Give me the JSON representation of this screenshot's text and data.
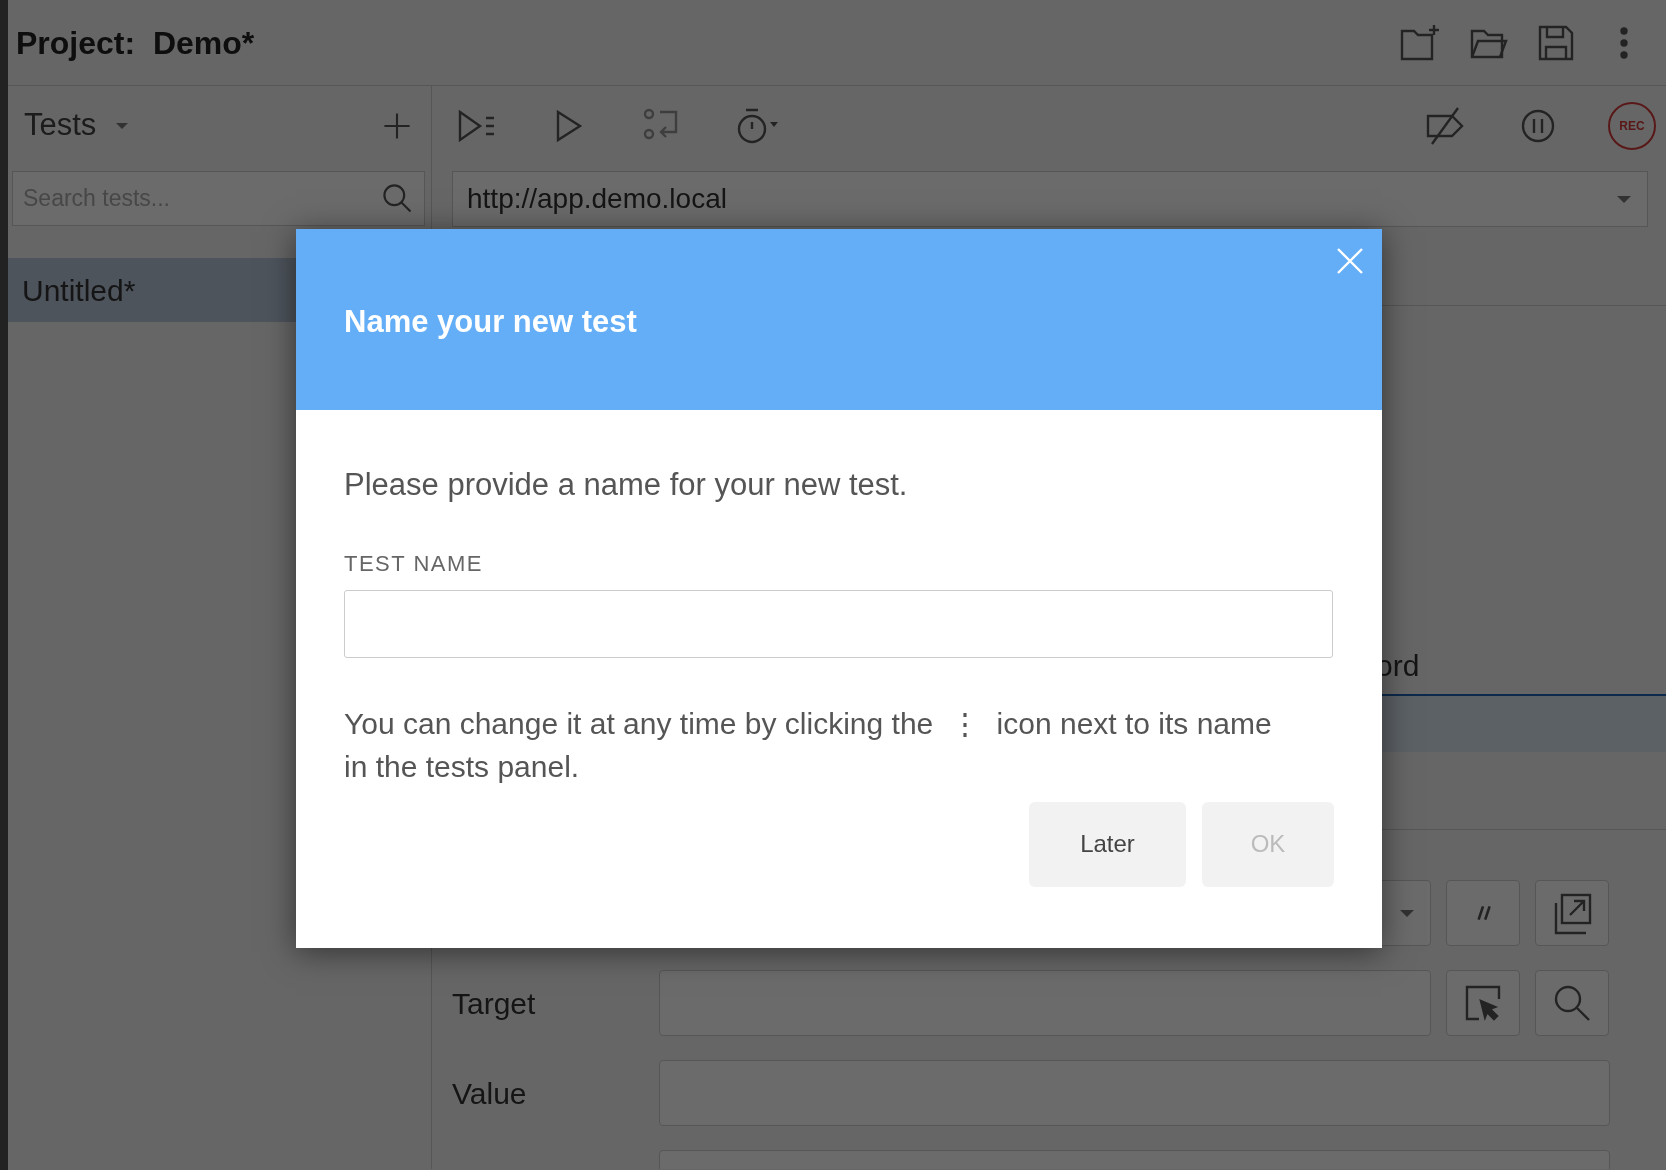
{
  "project": {
    "label": "Project:",
    "name": "Demo*"
  },
  "tests_panel": {
    "title": "Tests",
    "search": {
      "placeholder": "Search tests..."
    },
    "items": [
      {
        "name": "Untitled*",
        "selected": true
      }
    ]
  },
  "toolbar": {
    "record_label": "REC"
  },
  "url_bar": {
    "value": "http://app.demo.local"
  },
  "command_table": {
    "rows": [
      {
        "text": "ord",
        "selected": false
      },
      {
        "selected": true
      }
    ]
  },
  "command_editor": {
    "fields": [
      {
        "label": "Target"
      },
      {
        "label": "Value"
      }
    ]
  },
  "dialog": {
    "title": "Name your new test",
    "message": "Please provide a name for your new test.",
    "field_label": "TEST NAME",
    "hint": "You can change it at any time by clicking the  ⋮  icon next to its name in the tests panel.",
    "buttons": [
      {
        "label": "Later",
        "disabled": false
      },
      {
        "label": "OK",
        "disabled": true
      }
    ]
  }
}
